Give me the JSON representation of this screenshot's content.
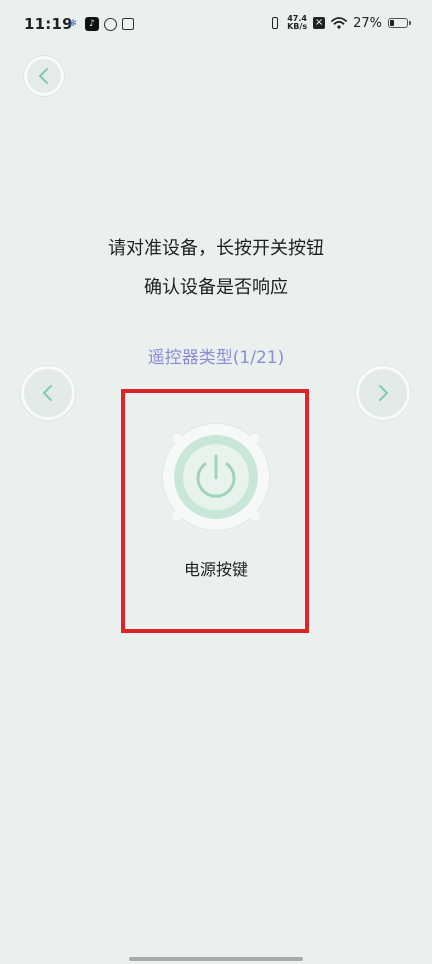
{
  "status_bar": {
    "time": "11:19",
    "net_speed_value": "47.4",
    "net_speed_unit": "KB/s",
    "battery_percent": "27%",
    "battery_level": 0.27,
    "icons_left": [
      "gear-icon",
      "tiktok-icon",
      "swirl-icon",
      "box-icon"
    ],
    "icons_right": [
      "vibrate-icon",
      "close-box-icon",
      "wifi-icon",
      "battery-icon"
    ]
  },
  "header": {
    "back_icon": "chevron-left-icon"
  },
  "instructions": {
    "line1": "请对准设备，长按开关按钮",
    "line2": "确认设备是否响应"
  },
  "remote_type": {
    "label": "遥控器类型(1/21)"
  },
  "navigation": {
    "prev_icon": "chevron-left-icon",
    "next_icon": "chevron-right-icon"
  },
  "power_button": {
    "icon": "power-icon",
    "label": "电源按键"
  },
  "colors": {
    "background": "#eaf0ed",
    "accent_purple": "#8c8bd6",
    "power_green": "#9fd4bb",
    "highlight_red": "#e0232b",
    "chevron_green": "#7fcbab"
  }
}
